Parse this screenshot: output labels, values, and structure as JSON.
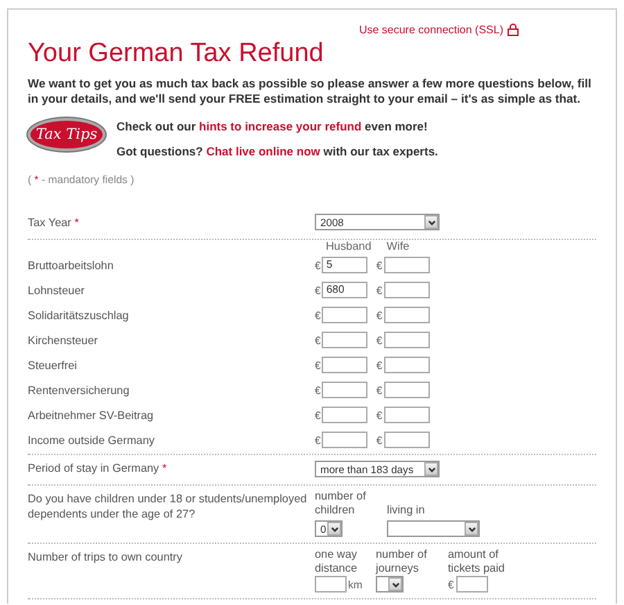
{
  "ssl_link": "Use secure connection (SSL)",
  "title": "Your German Tax Refund",
  "intro": "We want to get you as much tax back as possible so please answer a few more questions below, fill in your details, and we'll send your FREE estimation straight to your email – it's as simple as that.",
  "badge": "Tax Tips",
  "tips": [
    {
      "before": "Check out our ",
      "link": "hints to increase your refund",
      "after": " even more!"
    },
    {
      "before": "Got questions? ",
      "link": "Chat live online now",
      "after": " with our tax experts."
    }
  ],
  "mandatory_note": {
    "before": "( ",
    "mark": "*",
    "after": " - mandatory fields )"
  },
  "tax_year": {
    "label": "Tax Year",
    "required": true,
    "value": "2008"
  },
  "income_headers": [
    "Husband",
    "Wife"
  ],
  "income_rows": [
    {
      "label": "Bruttoarbeitslohn",
      "fields": [
        {
          "currency": "€",
          "value": "5"
        },
        {
          "currency": "€"
        }
      ]
    },
    {
      "label": "Lohnsteuer",
      "fields": [
        {
          "currency": "€",
          "value": "680"
        },
        {
          "currency": "€"
        }
      ]
    },
    {
      "label": "Solidaritätszuschlag",
      "fields": [
        {
          "currency": "€"
        },
        {
          "currency": "€"
        }
      ]
    },
    {
      "label": "Kirchensteuer",
      "fields": [
        {
          "currency": "€"
        },
        {
          "currency": "€"
        }
      ]
    },
    {
      "label": "Steuerfrei",
      "fields": [
        {
          "currency": "€"
        },
        {
          "currency": "€"
        }
      ]
    },
    {
      "label": "Rentenversicherung",
      "fields": [
        {
          "currency": "€"
        },
        {
          "currency": "€"
        }
      ]
    },
    {
      "label": "Arbeitnehmer SV-Beitrag",
      "fields": [
        {
          "currency": "€"
        },
        {
          "currency": "€"
        }
      ]
    },
    {
      "label": "Income outside Germany",
      "fields": [
        {
          "currency": "€"
        },
        {
          "currency": "€"
        }
      ]
    }
  ],
  "period": {
    "label": "Period of stay in Germany",
    "required": true,
    "value": "more than 183 days"
  },
  "children": {
    "question": "Do you have children under 18 or students/unemployed dependents under the age of 27?",
    "count_label": "number of children",
    "count_value": "0",
    "living_label": "living in"
  },
  "trips": {
    "label": "Number of trips to own country",
    "distance_label": "one way distance",
    "distance_unit": "km",
    "journeys_label": "number of journeys",
    "tickets_label": "amount of tickets paid",
    "tickets_currency": "€"
  }
}
